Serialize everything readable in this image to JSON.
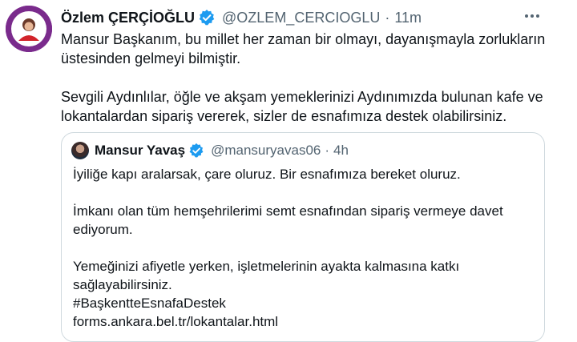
{
  "tweet": {
    "author_name": "Özlem ÇERÇİOĞLU",
    "handle": "@OZLEM_CERCIOGLU",
    "separator": "·",
    "time": "11m",
    "more_icon": "more-horizontal-icon",
    "paragraphs": [
      "Mansur Başkanım, bu millet her zaman bir olmayı, dayanışmayla zorlukların üstesinden gelmeyi bilmiştir.",
      "Sevgili Aydınlılar, öğle ve akşam yemeklerinizi Aydınımızda bulunan kafe ve lokantalardan sipariş vererek, sizler de esnafımıza destek olabilirsiniz."
    ]
  },
  "quoted": {
    "author_name": "Mansur Yavaş",
    "handle": "@mansuryavas06",
    "separator": "·",
    "time": "4h",
    "paragraphs": [
      "İyiliğe kapı aralarsak, çare oluruz. Bir esnafımıza bereket oluruz.",
      "İmkanı olan tüm hemşehrilerimi semt esnafından sipariş vermeye davet ediyorum.",
      "Yemeğinizi afiyetle yerken, işletmelerinin ayakta kalmasına katkı sağlayabilirsiniz."
    ],
    "hashtag": "#BaşkentteEsnafaDestek",
    "link": "forms.ankara.bel.tr/lokantalar.html"
  },
  "colors": {
    "verified": "#1d9bf0",
    "secondary_text": "#536471",
    "border": "#cfd9de",
    "avatar_bg": "#7a2b8c"
  }
}
